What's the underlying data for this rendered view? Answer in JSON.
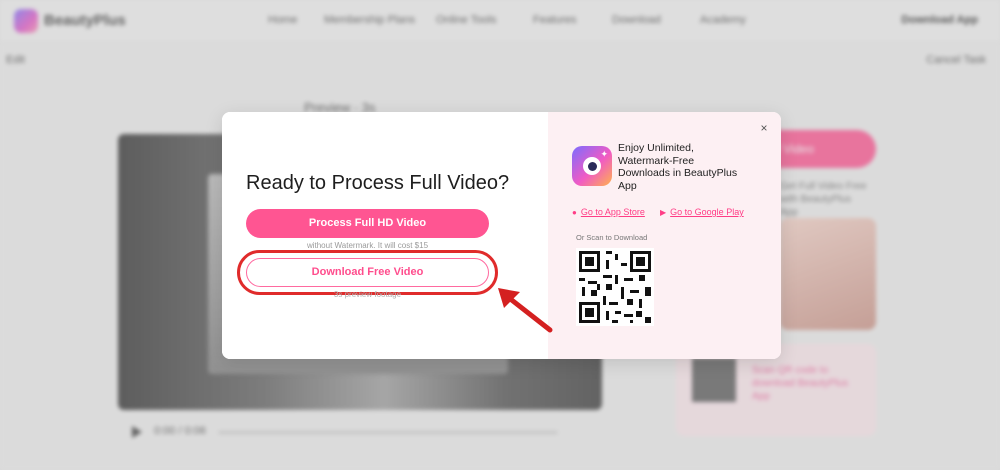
{
  "header": {
    "brand": "BeautyPlus",
    "nav": [
      "Home",
      "Membership Plans",
      "Online Tools",
      "Features",
      "Download",
      "Academy"
    ],
    "download_app": "Download App"
  },
  "subbar": {
    "back": "Edit",
    "cancel": "Cancel Task"
  },
  "page": {
    "heading": "Preview · 3s",
    "time": "0:00 / 0:06"
  },
  "sidebar": {
    "button": "Get Full Video",
    "text": "Get Full Video Free with BeautyPlus App",
    "card_text": "Scan QR code to download BeautyPlus App"
  },
  "modal": {
    "title": "Ready to Process Full Video?",
    "primary_button": "Process Full HD Video",
    "primary_note": "without Watermark. It will cost $15",
    "secondary_button": "Download Free Video",
    "secondary_note": "3s preview footage",
    "close": "×",
    "promo_text": "Enjoy Unlimited, Watermark-Free Downloads in BeautyPlus App",
    "app_store": "Go to App Store",
    "google_play": "Go to Google Play",
    "scan_label": "Or Scan to Download"
  },
  "colors": {
    "accent": "#ff5592",
    "highlight": "#e02b2b",
    "panel": "#fdf0f3"
  },
  "icons": {
    "close": "close-icon",
    "app_store": "apple-icon",
    "google_play": "play-icon",
    "annotation": "red-arrow"
  }
}
